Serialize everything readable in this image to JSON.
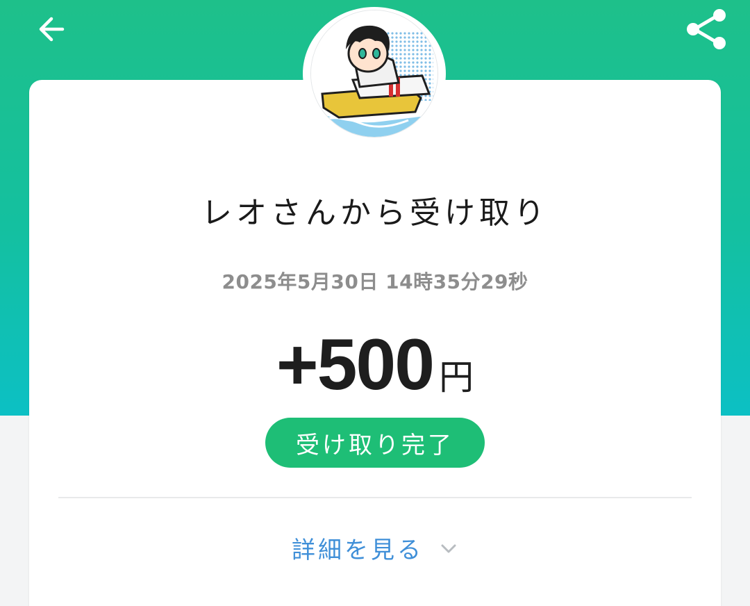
{
  "header": {
    "back_icon": "arrow-left-icon",
    "share_icon": "share-icon",
    "color_top": "#1ec08a",
    "color_bottom": "#0cc0c4"
  },
  "avatar": {
    "icon": "user-avatar-illustration"
  },
  "transaction": {
    "title": "レオさんから受け取り",
    "timestamp": "2025年5月30日 14時35分29秒",
    "amount": "+500",
    "currency": "円",
    "status": "受け取り完了"
  },
  "details": {
    "label": "詳細を見る",
    "icon": "chevron-down-icon"
  },
  "colors": {
    "status_badge": "#1ebe76",
    "link": "#3f8fd8",
    "timestamp": "#8d8d8d"
  }
}
